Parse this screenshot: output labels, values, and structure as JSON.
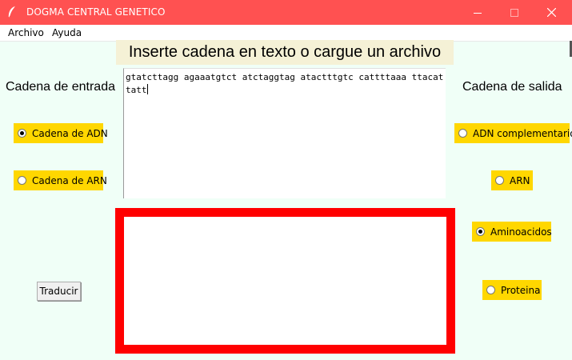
{
  "window": {
    "title": "DOGMA CENTRAL GENETICO",
    "titlebar_color": "#ff5151",
    "app_icon": "feather-icon",
    "controls": [
      "minimize-icon",
      "maximize-icon",
      "close-icon"
    ]
  },
  "menu": {
    "items": [
      {
        "label": "Archivo"
      },
      {
        "label": "Ayuda"
      }
    ]
  },
  "main": {
    "heading": "Inserte cadena en texto o cargue un archivo",
    "input_label": "Cadena de entrada",
    "output_label": "Cadena de salida",
    "input_text": "gtatcttagg agaaatgtct atctaggtag atactttgtc cattttaaa ttacattatt",
    "output_text": "",
    "output_border_color": "#ff0000",
    "radio_color": "#ffd700",
    "input_options": [
      {
        "label": "Cadena de ADN",
        "selected": true
      },
      {
        "label": "Cadena de ARN",
        "selected": false
      }
    ],
    "output_options": [
      {
        "label": "ADN complementario",
        "selected": false
      },
      {
        "label": "ARN",
        "selected": false
      },
      {
        "label": "Aminoacidos",
        "selected": true
      },
      {
        "label": "Proteina",
        "selected": false
      }
    ],
    "translate_button": "Traducir"
  }
}
